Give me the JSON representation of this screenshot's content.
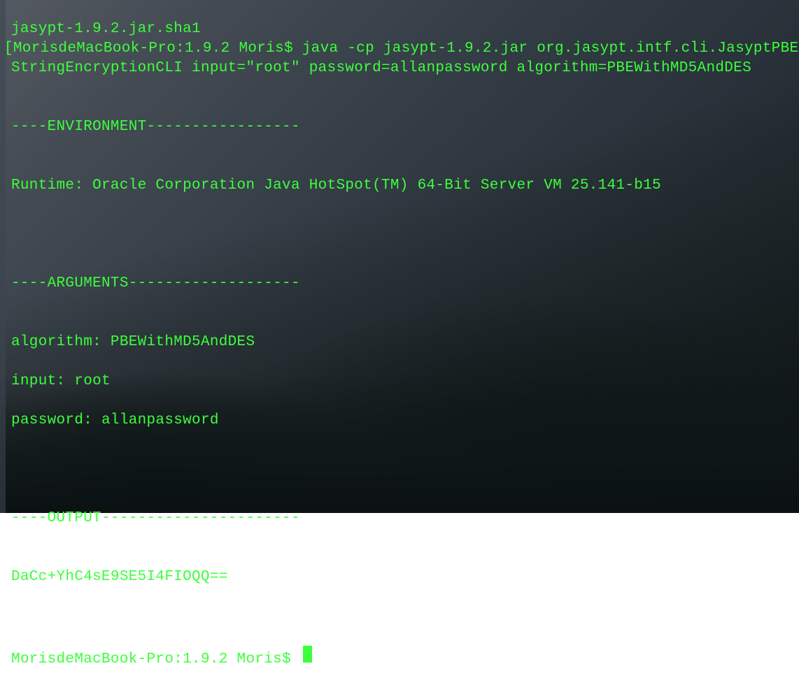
{
  "terminal": {
    "lines": {
      "line0": "jasypt-1.9.2.jar.sha1",
      "line1_bracket": "[",
      "line1": "MorisdeMacBook-Pro:1.9.2 Moris$ java -cp jasypt-1.9.2.jar org.jasypt.intf.cli.JasyptPBEStringEncryptionCLI input=\"root\" password=allanpassword algorithm=PBEWithMD5AndDES",
      "blank1": "",
      "env_header": "----ENVIRONMENT-----------------",
      "blank2": "",
      "runtime": "Runtime: Oracle Corporation Java HotSpot(TM) 64-Bit Server VM 25.141-b15",
      "blank3": "",
      "blank4": "",
      "blank5": "",
      "args_header": "----ARGUMENTS-------------------",
      "blank6": "",
      "algorithm": "algorithm: PBEWithMD5AndDES",
      "input": "input: root",
      "password": "password: allanpassword",
      "blank7": "",
      "blank8": "",
      "blank9": "",
      "output_header": "----OUTPUT----------------------",
      "blank10": "",
      "output_value": "DaCc+YhC4sE9SE5I4FIOQQ==",
      "blank11": "",
      "blank12": "",
      "prompt": "MorisdeMacBook-Pro:1.9.2 Moris$ "
    }
  }
}
